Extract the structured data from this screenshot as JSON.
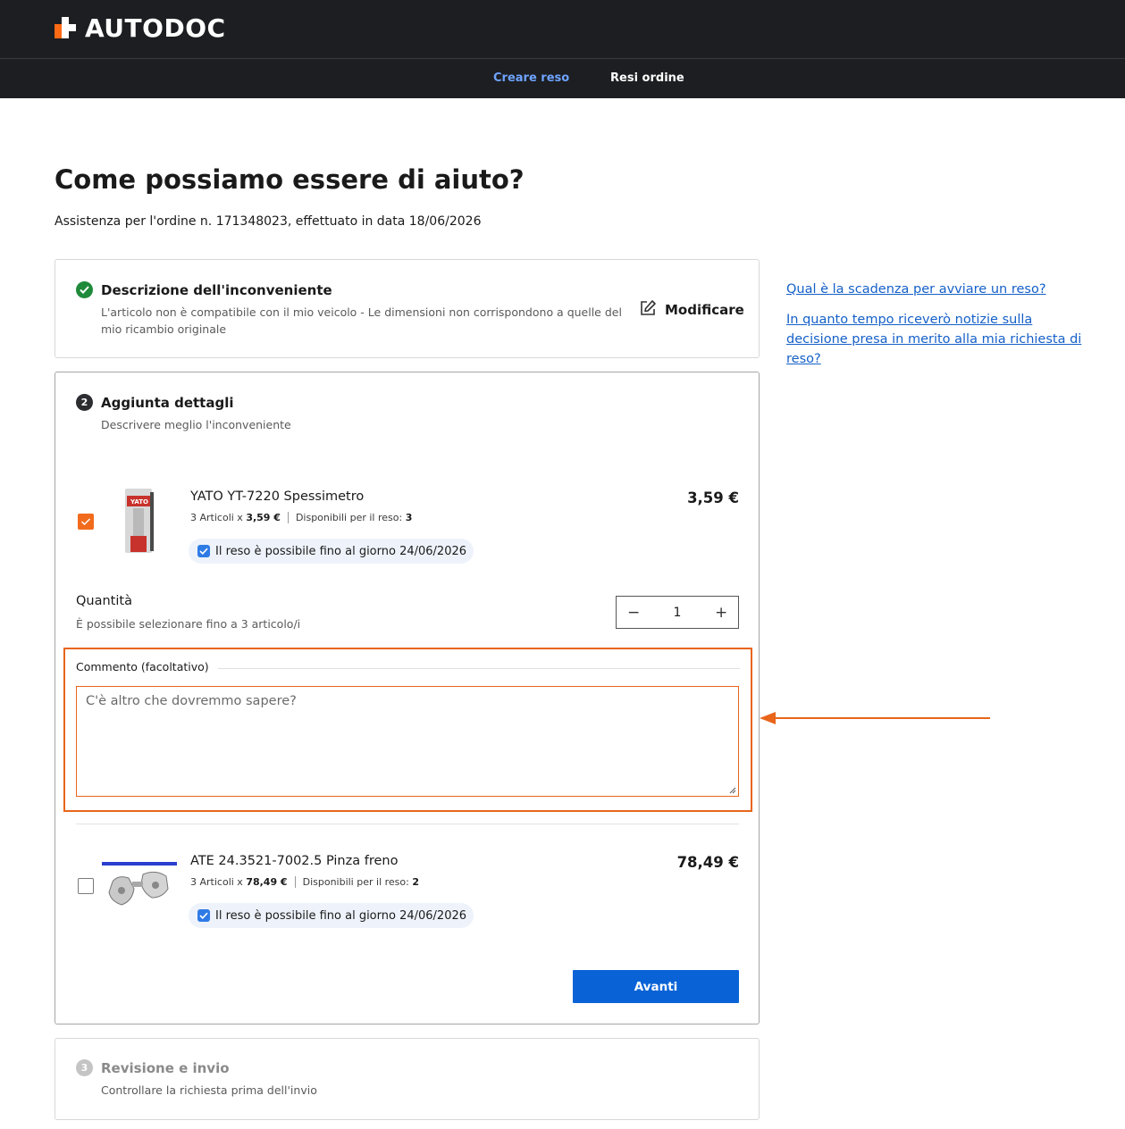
{
  "header": {
    "brand": "AUTODOC",
    "nav": {
      "create_return": "Creare reso",
      "order_returns": "Resi ordine"
    }
  },
  "page": {
    "title": "Come possiamo essere di aiuto?",
    "subtitle": "Assistenza per l'ordine n. 171348023, effettuato in data 18/06/2026"
  },
  "step1": {
    "title": "Descrizione dell'inconveniente",
    "description_line1": "L'articolo non è compatibile con il mio veicolo - Le dimensioni non corrispondono a quelle del",
    "description_line2": "mio ricambio originale",
    "modify_label": "Modificare",
    "status": "completed"
  },
  "step2": {
    "number": "2",
    "title": "Aggiunta dettagli",
    "subtitle": "Descrivere meglio l'inconveniente",
    "products": [
      {
        "name": "YATO YT-7220 Spessimetro",
        "qty_prefix": "3 Articoli x",
        "unit_price": "3,59 €",
        "available_label": "Disponibili per il reso:",
        "available": "3",
        "price": "3,59 €",
        "return_until": "Il reso è possibile fino al giorno 24/06/2026",
        "selected": true
      },
      {
        "name": "ATE 24.3521-7002.5 Pinza freno",
        "qty_prefix": "3 Articoli x",
        "unit_price": "78,49 €",
        "available_label": "Disponibili per il reso:",
        "available": "2",
        "price": "78,49 €",
        "return_until": "Il reso è possibile fino al giorno 24/06/2026",
        "selected": false
      }
    ],
    "quantity": {
      "label": "Quantità",
      "hint": "È possibile selezionare fino a 3 articolo/i",
      "value": "1",
      "minus": "−",
      "plus": "+"
    },
    "comment": {
      "label": "Commento (facoltativo)",
      "placeholder": "C'è altro che dovremmo sapere?"
    },
    "next_label": "Avanti"
  },
  "step3": {
    "number": "3",
    "title": "Revisione e invio",
    "subtitle": "Controllare la richiesta prima dell'invio"
  },
  "help_links": [
    "Qual è la scadenza per avviare un reso?",
    "In quanto tempo riceverò notizie sulla decisione presa in merito alla mia richiesta di reso?"
  ],
  "colors": {
    "header_bg": "#1c1e21",
    "accent_orange": "#f26b1d",
    "primary_blue": "#0a63d6",
    "link_blue": "#1560c8",
    "success_green": "#1f8a3a"
  }
}
